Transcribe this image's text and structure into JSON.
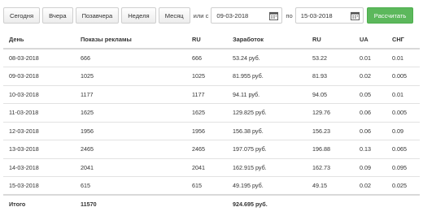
{
  "toolbar": {
    "buttons": [
      "Сегодня",
      "Вчера",
      "Позавчера",
      "Неделя",
      "Месяц"
    ],
    "or_label": "или с",
    "from_date": "09-03-2018",
    "to_label": "по",
    "to_date": "15-03-2018",
    "calc_label": "Рассчитать",
    "calendar_icon": "calendar-icon",
    "accent_color": "#5cb85c"
  },
  "table": {
    "headers": [
      "День",
      "Показы рекламы",
      "RU",
      "Заработок",
      "RU",
      "UA",
      "СНГ"
    ],
    "rows": [
      [
        "08-03-2018",
        "666",
        "666",
        "53.24 руб.",
        "53.22",
        "0.01",
        "0.01"
      ],
      [
        "09-03-2018",
        "1025",
        "1025",
        "81.955 руб.",
        "81.93",
        "0.02",
        "0.005"
      ],
      [
        "10-03-2018",
        "1177",
        "1177",
        "94.11 руб.",
        "94.05",
        "0.05",
        "0.01"
      ],
      [
        "11-03-2018",
        "1625",
        "1625",
        "129.825 руб.",
        "129.76",
        "0.06",
        "0.005"
      ],
      [
        "12-03-2018",
        "1956",
        "1956",
        "156.38 руб.",
        "156.23",
        "0.06",
        "0.09"
      ],
      [
        "13-03-2018",
        "2465",
        "2465",
        "197.075 руб.",
        "196.88",
        "0.13",
        "0.065"
      ],
      [
        "14-03-2018",
        "2041",
        "2041",
        "162.915 руб.",
        "162.73",
        "0.09",
        "0.095"
      ],
      [
        "15-03-2018",
        "615",
        "615",
        "49.195 руб.",
        "49.15",
        "0.02",
        "0.025"
      ]
    ],
    "total": [
      "Итого",
      "11570",
      "",
      "924.695 руб.",
      "",
      "",
      ""
    ]
  }
}
